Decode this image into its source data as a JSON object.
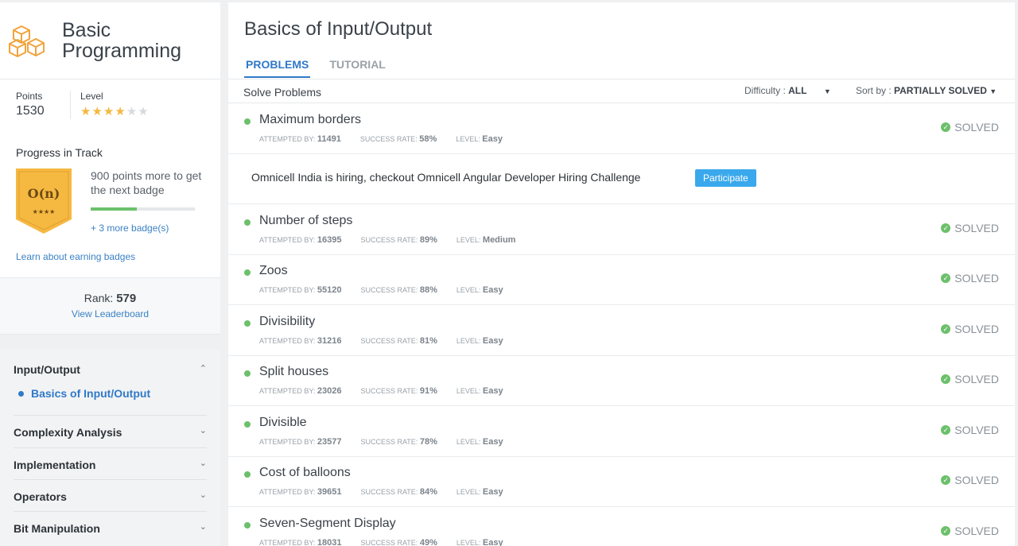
{
  "track": {
    "title_line1": "Basic",
    "title_line2": "Programming"
  },
  "stats": {
    "points_label": "Points",
    "points_value": "1530",
    "level_label": "Level",
    "stars_filled": 4,
    "stars_total": 6
  },
  "progress": {
    "label": "Progress in Track",
    "badge_text": "O(n)",
    "badge_stars": "★★★★",
    "message": "900 points more to get the next badge",
    "fraction": 0.44,
    "more_badges": "+ 3 more badge(s)",
    "learn_link": "Learn about earning badges"
  },
  "rank": {
    "label": "Rank:",
    "value": "579",
    "leaderboard_link": "View Leaderboard"
  },
  "nav": {
    "groups": [
      {
        "title": "Input/Output",
        "expanded": true,
        "sub_items": [
          "Basics of Input/Output"
        ]
      },
      {
        "title": "Complexity Analysis",
        "expanded": false
      },
      {
        "title": "Implementation",
        "expanded": false
      },
      {
        "title": "Operators",
        "expanded": false
      },
      {
        "title": "Bit Manipulation",
        "expanded": false
      }
    ]
  },
  "main": {
    "title": "Basics of Input/Output",
    "tabs": [
      "PROBLEMS",
      "TUTORIAL"
    ],
    "active_tab": "PROBLEMS",
    "solve_label": "Solve Problems",
    "difficulty_label": "Difficulty :",
    "difficulty_value": "ALL",
    "sort_label": "Sort by :",
    "sort_value": "PARTIALLY SOLVED"
  },
  "meta_labels": {
    "attempted": "ATTEMPTED BY:",
    "success": "SUCCESS RATE:",
    "level": "LEVEL:"
  },
  "problems": [
    {
      "name": "Maximum borders",
      "attempted": "11491",
      "success": "58%",
      "level": "Easy",
      "status": "SOLVED"
    },
    {
      "name": "Number of steps",
      "attempted": "16395",
      "success": "89%",
      "level": "Medium",
      "status": "SOLVED"
    },
    {
      "name": "Zoos",
      "attempted": "55120",
      "success": "88%",
      "level": "Easy",
      "status": "SOLVED"
    },
    {
      "name": "Divisibility",
      "attempted": "31216",
      "success": "81%",
      "level": "Easy",
      "status": "SOLVED"
    },
    {
      "name": "Split houses",
      "attempted": "23026",
      "success": "91%",
      "level": "Easy",
      "status": "SOLVED"
    },
    {
      "name": "Divisible",
      "attempted": "23577",
      "success": "78%",
      "level": "Easy",
      "status": "SOLVED"
    },
    {
      "name": "Cost of balloons",
      "attempted": "39651",
      "success": "84%",
      "level": "Easy",
      "status": "SOLVED"
    },
    {
      "name": "Seven-Segment Display",
      "attempted": "18031",
      "success": "49%",
      "level": "Easy",
      "status": "SOLVED"
    }
  ],
  "promo": {
    "text": "Omnicell India is hiring, checkout Omnicell Angular Developer Hiring Challenge",
    "button": "Participate"
  },
  "colors": {
    "accent": "#2f79c9",
    "success": "#6cc06b",
    "star": "#f5b841",
    "badge": "#f5b841",
    "button": "#3aa8ec"
  }
}
